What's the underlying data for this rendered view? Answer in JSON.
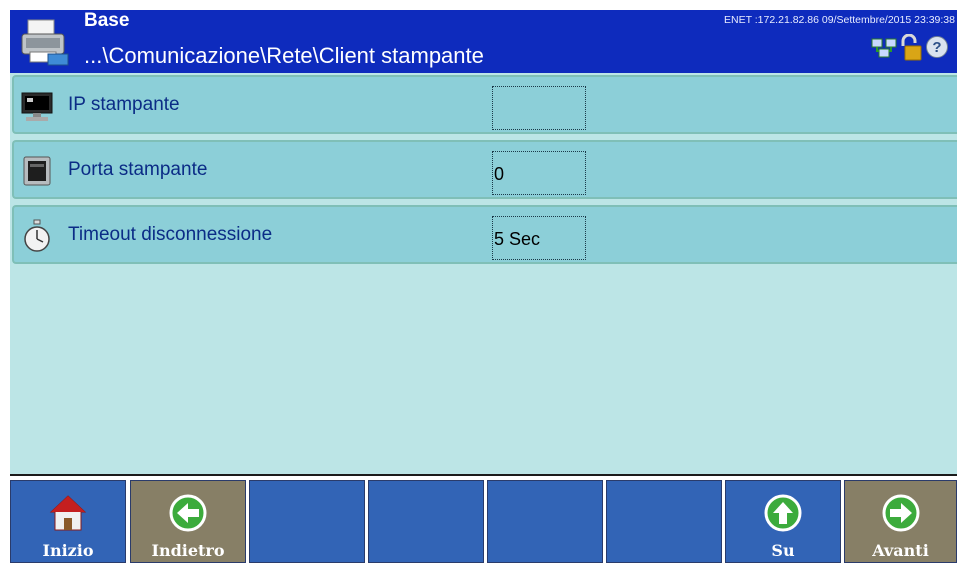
{
  "header": {
    "title": "Base",
    "path": "...\\Comunicazione\\Rete\\Client stampante",
    "status": "ENET :172.21.82.86  09/Settembre/2015 23:39:38",
    "icons": [
      "network-icon",
      "unlock-icon",
      "help-icon"
    ]
  },
  "rows": [
    {
      "label": "IP stampante",
      "value": "",
      "icon": "monitor-icon"
    },
    {
      "label": "Porta stampante",
      "value": "0",
      "icon": "port-icon"
    },
    {
      "label": "Timeout disconnessione",
      "value": "5 Sec",
      "icon": "stopwatch-icon"
    }
  ],
  "footer": {
    "buttons": [
      {
        "label": "Inizio",
        "icon": "home-icon",
        "color": "blue"
      },
      {
        "label": "Indietro",
        "icon": "arrow-left-icon",
        "color": "tan"
      },
      {
        "label": "",
        "icon": "",
        "color": "blue"
      },
      {
        "label": "",
        "icon": "",
        "color": "blue"
      },
      {
        "label": "",
        "icon": "",
        "color": "blue"
      },
      {
        "label": "",
        "icon": "",
        "color": "blue"
      },
      {
        "label": "Su",
        "icon": "arrow-up-icon",
        "color": "blue"
      },
      {
        "label": "Avanti",
        "icon": "arrow-right-icon",
        "color": "tan"
      }
    ]
  },
  "colors": {
    "header_bg": "#0e2bbd",
    "content_bg": "#bce5e6",
    "row_bg": "#8ccfd8",
    "button_blue": "#3264b6",
    "button_tan": "#877f66"
  }
}
